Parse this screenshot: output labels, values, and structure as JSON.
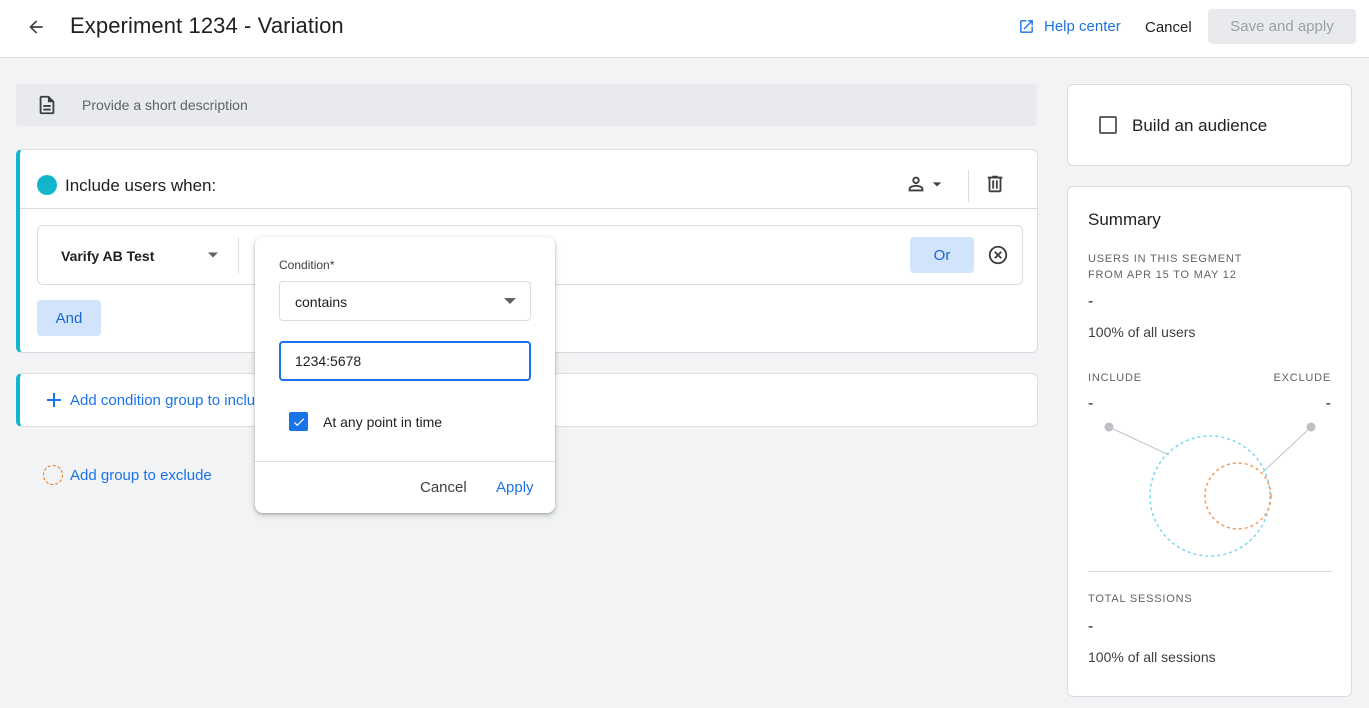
{
  "header": {
    "title": "Experiment 1234 - Variation",
    "help_label": "Help center",
    "cancel_label": "Cancel",
    "save_label": "Save and apply"
  },
  "description": {
    "placeholder": "Provide a short description"
  },
  "include_group": {
    "title": "Include users when:",
    "dimension": "Varify AB Test",
    "or_label": "Or",
    "and_label": "And",
    "accent_color": "#12b5cb"
  },
  "add_include_group_label": "Add condition group to include",
  "add_exclude_group_label": "Add group to exclude",
  "condition_popup": {
    "label": "Condition*",
    "operator": "contains",
    "value": "1234:5678",
    "any_point_label": "At any point in time",
    "any_point_checked": true,
    "cancel_label": "Cancel",
    "apply_label": "Apply"
  },
  "audience": {
    "label": "Build an audience",
    "checked": false
  },
  "summary": {
    "title": "Summary",
    "users_label_line1": "USERS IN THIS SEGMENT",
    "users_label_line2": "FROM APR 15 TO MAY 12",
    "users_value": "-",
    "users_pct": "100% of all users",
    "include_label": "INCLUDE",
    "include_value": "-",
    "exclude_label": "EXCLUDE",
    "exclude_value": "-",
    "total_label": "TOTAL SESSIONS",
    "total_value": "-",
    "total_pct": "100% of all sessions"
  },
  "colors": {
    "primary": "#1a73e8",
    "include": "#12b5cb",
    "exclude": "#e8710a"
  }
}
